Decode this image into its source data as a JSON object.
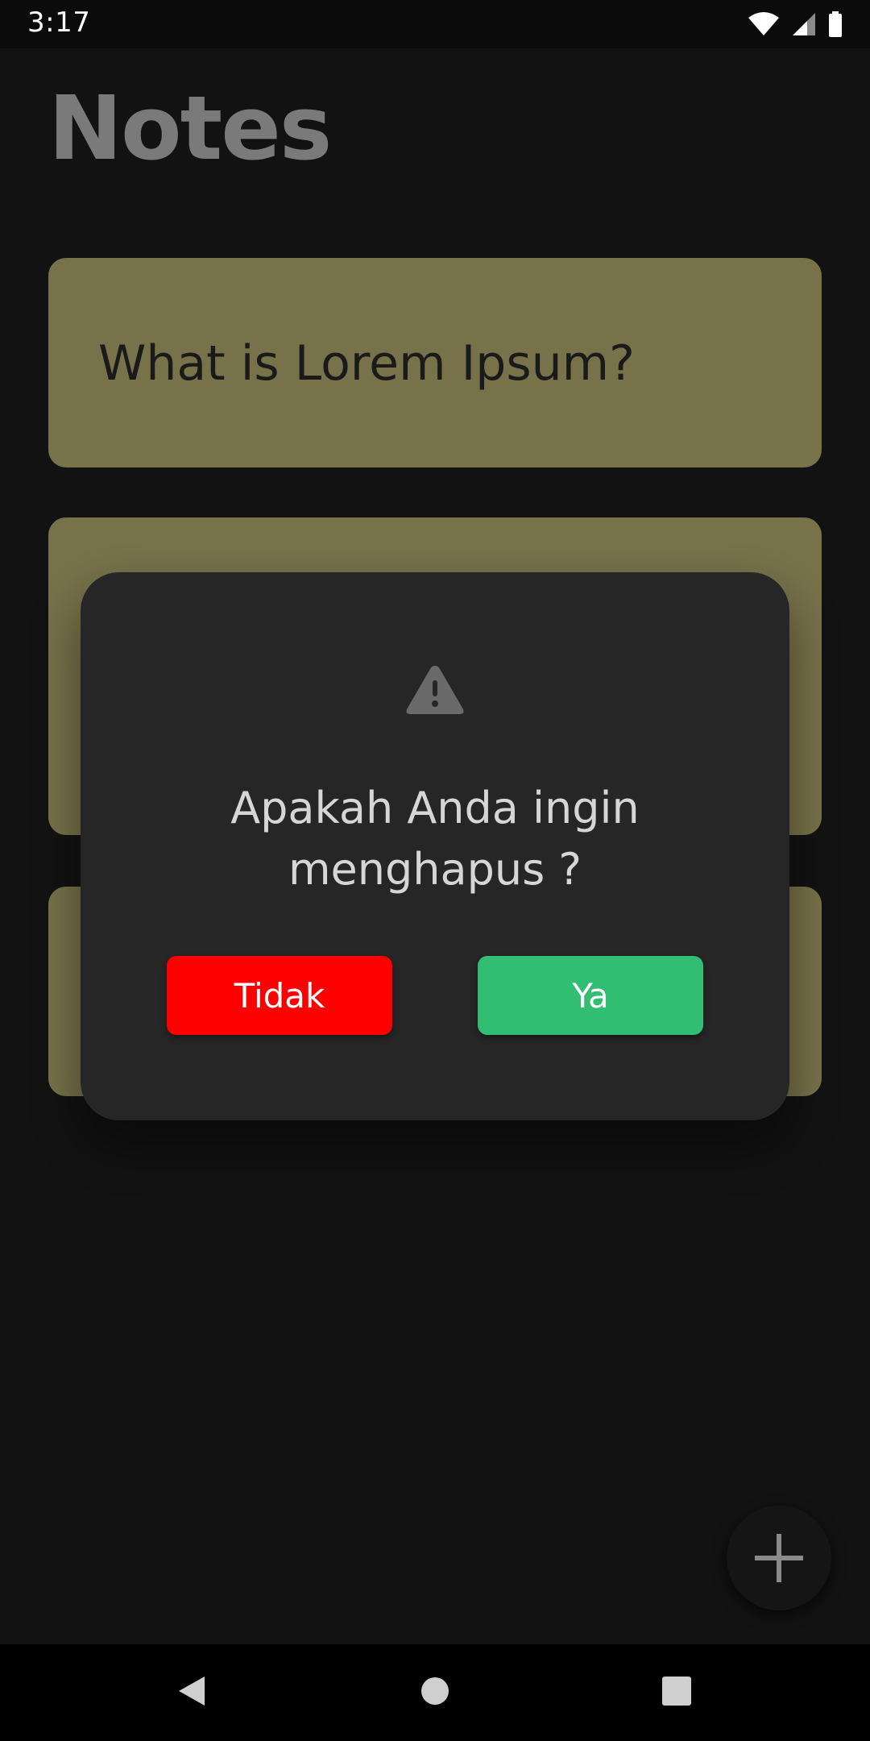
{
  "status_bar": {
    "time": "3:17",
    "icons": [
      "wifi-icon",
      "cell-signal-icon",
      "battery-icon"
    ]
  },
  "app": {
    "title": "Notes"
  },
  "notes": [
    {
      "title": "What is Lorem Ipsum?"
    },
    {
      "title": ""
    },
    {
      "title": ""
    }
  ],
  "dialog": {
    "icon": "warning-icon",
    "message": "Apakah Anda ingin menghapus ?",
    "cancel_label": "Tidak",
    "confirm_label": "Ya"
  },
  "fab": {
    "icon": "plus-icon"
  },
  "nav_bar": {
    "icons": [
      "back-icon",
      "home-icon",
      "recents-icon"
    ]
  },
  "colors": {
    "background": "#121212",
    "note_card": "#77724a",
    "dialog_bg": "#262626",
    "cancel_button": "#ff0000",
    "confirm_button": "#31bd72"
  }
}
